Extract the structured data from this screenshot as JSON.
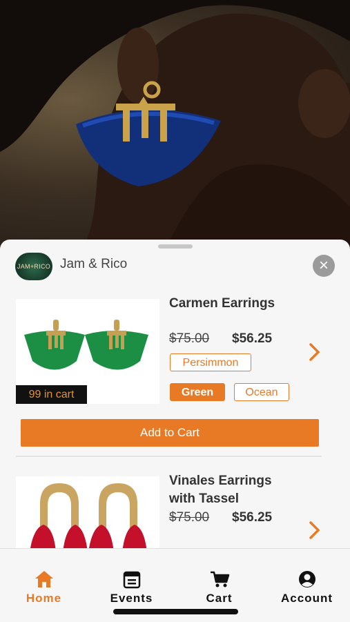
{
  "brand": {
    "name": "Jam & Rico",
    "logo_text": "JAM+RICO"
  },
  "colors": {
    "accent": "#e87a26",
    "sheet_bg": "#f6f6f6"
  },
  "close_icon": "close-icon",
  "products": [
    {
      "title": "Carmen Earrings",
      "old_price": "$75.00",
      "new_price": "$56.25",
      "cart_badge": "99 in cart",
      "options_row1": [
        "Persimmon"
      ],
      "options_row2": [
        "Green",
        "Ocean"
      ],
      "selected_option": "Green",
      "add_to_cart": "Add to Cart"
    },
    {
      "title_line1": "Vinales Earrings",
      "title_line2": "with Tassel",
      "old_price": "$75.00",
      "new_price": "$56.25"
    }
  ],
  "tabs": [
    {
      "label": "Home",
      "icon": "home-icon",
      "active": true
    },
    {
      "label": "Events",
      "icon": "calendar-icon",
      "active": false
    },
    {
      "label": "Cart",
      "icon": "cart-icon",
      "active": false
    },
    {
      "label": "Account",
      "icon": "account-icon",
      "active": false
    }
  ]
}
